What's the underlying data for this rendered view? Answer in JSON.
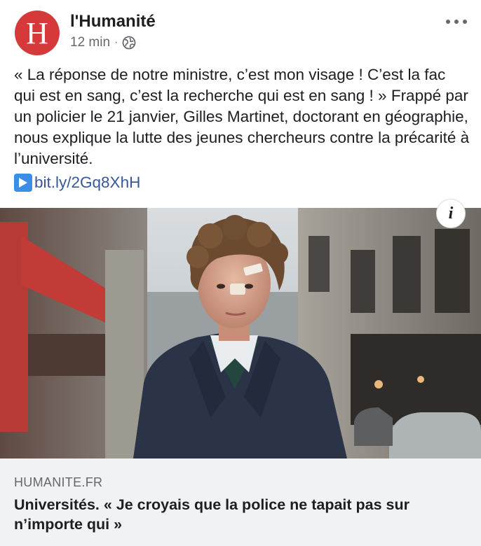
{
  "post": {
    "page_name": "l'Humanité",
    "avatar_letter": "H",
    "time": "12 min",
    "separator": "·",
    "audience_icon": "globe-icon",
    "more_icon": "more-options-icon",
    "text": "« La réponse de notre ministre, c’est mon visage ! C’est la fac qui est en sang, c’est la recherche qui est en sang ! » Frappé par un policier le 21 janvier, Gilles Martinet, doctorant en géographie, nous explique la lutte des jeunes chercheurs contre la précarité à l’université.",
    "link_icon": "play-button-icon",
    "short_link": "bit.ly/2Gq8XhH"
  },
  "image": {
    "info_label": "i",
    "description_icon": "photo-of-man-in-street"
  },
  "link_card": {
    "domain": "HUMANITE.FR",
    "headline": "Universités. « Je croyais que la police ne tapait pas sur n’importe qui »"
  },
  "colors": {
    "avatar_bg": "#d6393a",
    "link": "#385898",
    "card_bg": "#f0f2f5",
    "play_icon": "#3a8ee6"
  }
}
